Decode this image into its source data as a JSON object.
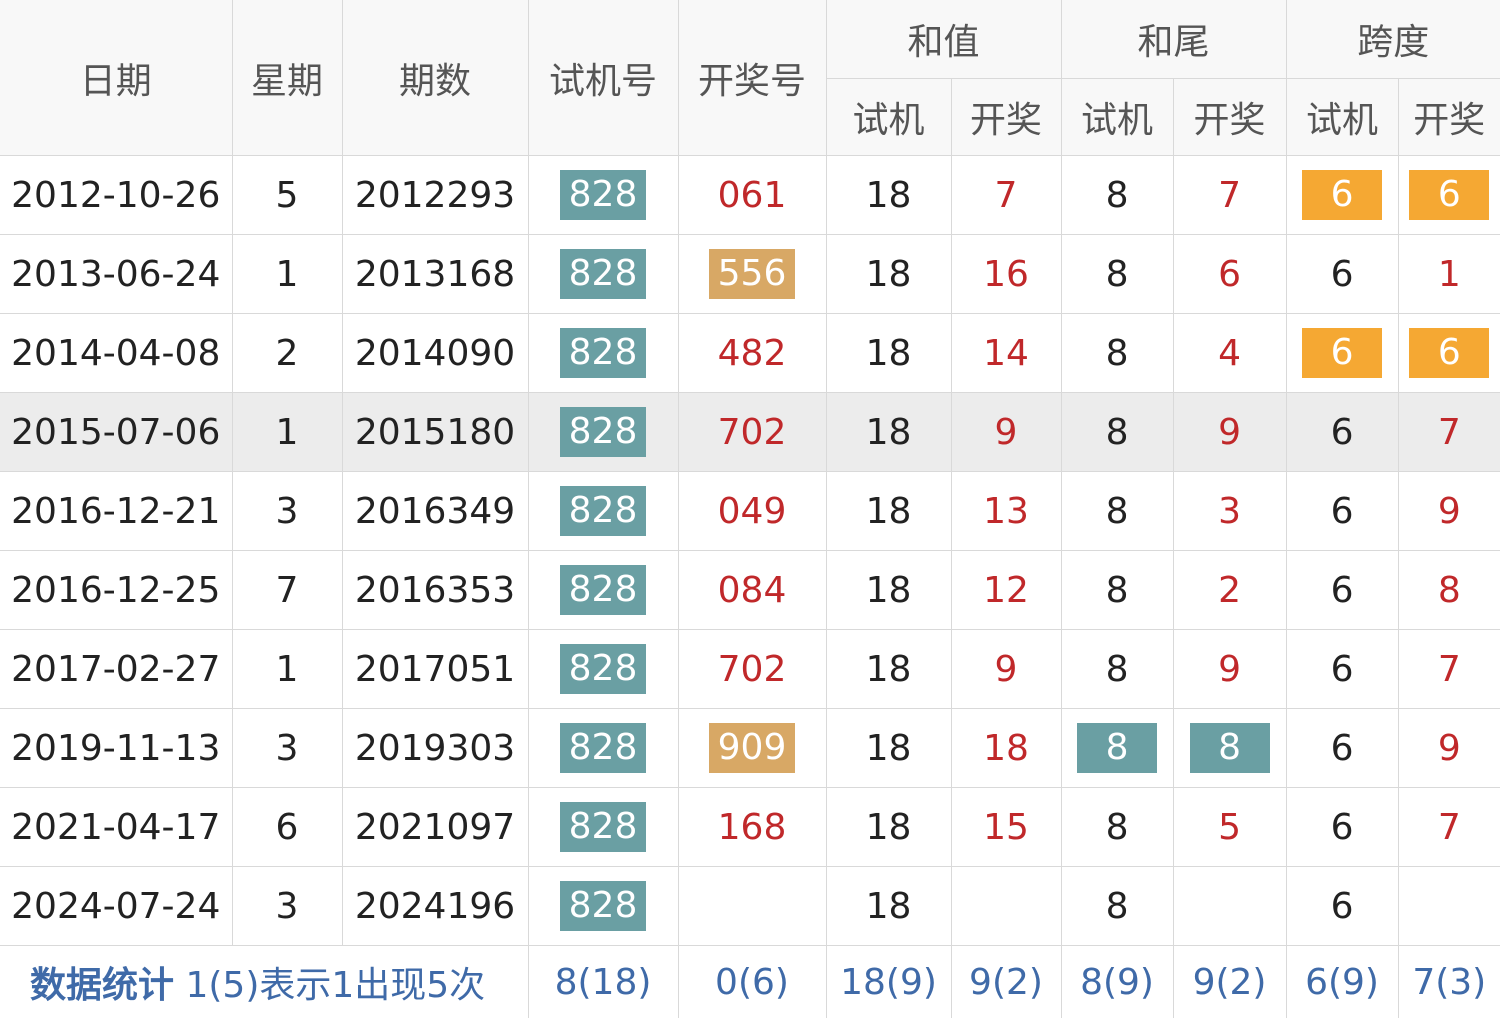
{
  "headers": {
    "date": "日期",
    "weekday": "星期",
    "issue": "期数",
    "trial_number": "试机号",
    "draw_number": "开奖号",
    "sum": "和值",
    "sum_tail": "和尾",
    "span": "跨度",
    "sub_trial": "试机",
    "sub_draw": "开奖"
  },
  "rows": [
    {
      "date": "2012-10-26",
      "weekday": "5",
      "issue": "2012293",
      "trial": "828",
      "draw": "061",
      "sum_trial": "18",
      "sum_draw": "7",
      "tail_trial": "8",
      "tail_draw": "7",
      "span_trial": "6",
      "span_draw": "6"
    },
    {
      "date": "2013-06-24",
      "weekday": "1",
      "issue": "2013168",
      "trial": "828",
      "draw": "556",
      "sum_trial": "18",
      "sum_draw": "16",
      "tail_trial": "8",
      "tail_draw": "6",
      "span_trial": "6",
      "span_draw": "1"
    },
    {
      "date": "2014-04-08",
      "weekday": "2",
      "issue": "2014090",
      "trial": "828",
      "draw": "482",
      "sum_trial": "18",
      "sum_draw": "14",
      "tail_trial": "8",
      "tail_draw": "4",
      "span_trial": "6",
      "span_draw": "6"
    },
    {
      "date": "2015-07-06",
      "weekday": "1",
      "issue": "2015180",
      "trial": "828",
      "draw": "702",
      "sum_trial": "18",
      "sum_draw": "9",
      "tail_trial": "8",
      "tail_draw": "9",
      "span_trial": "6",
      "span_draw": "7"
    },
    {
      "date": "2016-12-21",
      "weekday": "3",
      "issue": "2016349",
      "trial": "828",
      "draw": "049",
      "sum_trial": "18",
      "sum_draw": "13",
      "tail_trial": "8",
      "tail_draw": "3",
      "span_trial": "6",
      "span_draw": "9"
    },
    {
      "date": "2016-12-25",
      "weekday": "7",
      "issue": "2016353",
      "trial": "828",
      "draw": "084",
      "sum_trial": "18",
      "sum_draw": "12",
      "tail_trial": "8",
      "tail_draw": "2",
      "span_trial": "6",
      "span_draw": "8"
    },
    {
      "date": "2017-02-27",
      "weekday": "1",
      "issue": "2017051",
      "trial": "828",
      "draw": "702",
      "sum_trial": "18",
      "sum_draw": "9",
      "tail_trial": "8",
      "tail_draw": "9",
      "span_trial": "6",
      "span_draw": "7"
    },
    {
      "date": "2019-11-13",
      "weekday": "3",
      "issue": "2019303",
      "trial": "828",
      "draw": "909",
      "sum_trial": "18",
      "sum_draw": "18",
      "tail_trial": "8",
      "tail_draw": "8",
      "span_trial": "6",
      "span_draw": "9"
    },
    {
      "date": "2021-04-17",
      "weekday": "6",
      "issue": "2021097",
      "trial": "828",
      "draw": "168",
      "sum_trial": "18",
      "sum_draw": "15",
      "tail_trial": "8",
      "tail_draw": "5",
      "span_trial": "6",
      "span_draw": "7"
    },
    {
      "date": "2024-07-24",
      "weekday": "3",
      "issue": "2024196",
      "trial": "828",
      "draw": "",
      "sum_trial": "18",
      "sum_draw": "",
      "tail_trial": "8",
      "tail_draw": "",
      "span_trial": "6",
      "span_draw": ""
    }
  ],
  "stats": {
    "title": "数据统计",
    "note": "1(5)表示1出现5次",
    "trial": "8(18)",
    "draw": "0(6)",
    "sum_trial": "18(9)",
    "sum_draw": "9(2)",
    "tail_trial": "8(9)",
    "tail_draw": "9(2)",
    "span_trial": "6(9)",
    "span_draw": "7(3)"
  },
  "colors": {
    "teal_box": "#6a9fa3",
    "tan_box": "#d8a865",
    "orange_box": "#f5a833",
    "draw_text_red": "#c0282a",
    "stats_blue": "#3f6aa8",
    "highlight_row": "#ececec"
  }
}
